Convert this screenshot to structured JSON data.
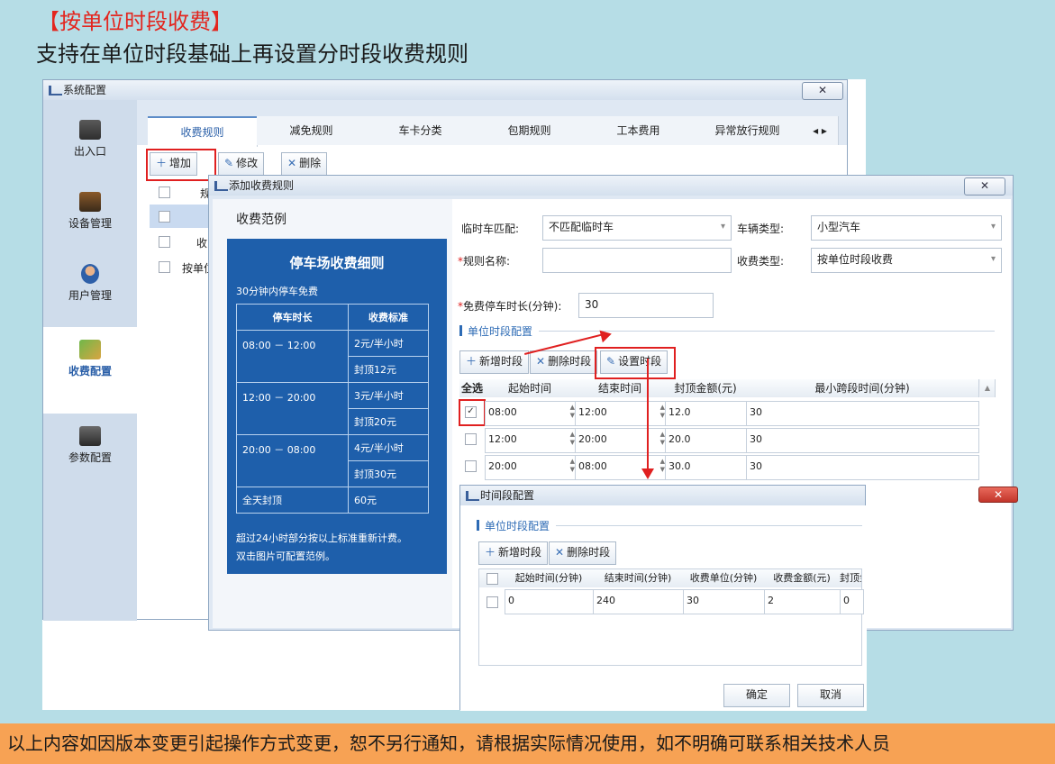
{
  "heading": "【按单位时段收费】",
  "subheading": "支持在单位时段基础上再设置分时段收费规则",
  "footer": "以上内容如因版本变更引起操作方式变更，恕不另行通知，请根据实际情况使用，如不明确可联系相关技术人员",
  "colors": {
    "accent": "#2d6bb5",
    "highlight": "#e02020",
    "footer_bg": "#f7a254",
    "panel_bg": "#1e5fab"
  },
  "sysconfig": {
    "title": "系统配置",
    "close": "✕",
    "sidebar": [
      {
        "label": "出入口",
        "icon": "gate-icon"
      },
      {
        "label": "设备管理",
        "icon": "device-icon"
      },
      {
        "label": "用户管理",
        "icon": "user-icon"
      },
      {
        "label": "收费配置",
        "icon": "fee-icon"
      },
      {
        "label": "参数配置",
        "icon": "monitor-icon"
      }
    ],
    "tabs": [
      "收费规则",
      "减免规则",
      "车卡分类",
      "包期规则",
      "工本费用",
      "异常放行规则"
    ],
    "tab_scroll": "◂ ▸",
    "toolbar": {
      "add": "增加",
      "edit": "修改",
      "delete": "删除"
    },
    "list_rows": [
      "规",
      "",
      "收",
      "按单位"
    ]
  },
  "addrule": {
    "title": "添加收费规则",
    "close": "✕",
    "example_title": "收费范例",
    "panel": {
      "title": "停车场收费细则",
      "free_note": "30分钟内停车免费",
      "col_duration": "停车时长",
      "col_standard": "收费标准",
      "rows": [
        {
          "duration": "08:00 － 12:00",
          "rate": "2元/半小时",
          "cap": "封顶12元"
        },
        {
          "duration": "12:00 － 20:00",
          "rate": "3元/半小时",
          "cap": "封顶20元"
        },
        {
          "duration": "20:00 － 08:00",
          "rate": "4元/半小时",
          "cap": "封顶30元"
        }
      ],
      "allday_label": "全天封顶",
      "allday_value": "60元",
      "note1": "超过24小时部分按以上标准重新计费。",
      "note2": "双击图片可配置范例。"
    },
    "form": {
      "temp_match_label": "临时车匹配:",
      "temp_match_value": "不匹配临时车",
      "vehicle_type_label": "车辆类型:",
      "vehicle_type_value": "小型汽车",
      "rule_name_label": "规则名称:",
      "rule_name_value": "",
      "fee_type_label": "收费类型:",
      "fee_type_value": "按单位时段收费",
      "free_time_label": "免费停车时长(分钟):",
      "free_time_value": "30"
    },
    "section": "单位时段配置",
    "buttons": {
      "add": "新增时段",
      "delete": "删除时段",
      "set": "设置时段"
    },
    "grid_headers": [
      "全选",
      "起始时间",
      "结束时间",
      "封顶金额(元)",
      "最小跨段时间(分钟)"
    ],
    "rows": [
      {
        "start": "08:00",
        "end": "12:00",
        "cap": "12.0",
        "min": "30",
        "checked": true
      },
      {
        "start": "12:00",
        "end": "20:00",
        "cap": "20.0",
        "min": "30",
        "checked": false
      },
      {
        "start": "20:00",
        "end": "08:00",
        "cap": "30.0",
        "min": "30",
        "checked": false
      }
    ]
  },
  "period": {
    "title": "时间段配置",
    "close": "✕",
    "section": "单位时段配置",
    "buttons": {
      "add": "新增时段",
      "delete": "删除时段"
    },
    "headers": [
      "起始时间(分钟)",
      "结束时间(分钟)",
      "收费单位(分钟)",
      "收费金额(元)",
      "封顶金额(元)"
    ],
    "rows": [
      {
        "start": "0",
        "end": "240",
        "unit": "30",
        "amount": "2",
        "cap": "0"
      }
    ],
    "ok": "确定",
    "cancel": "取消"
  }
}
